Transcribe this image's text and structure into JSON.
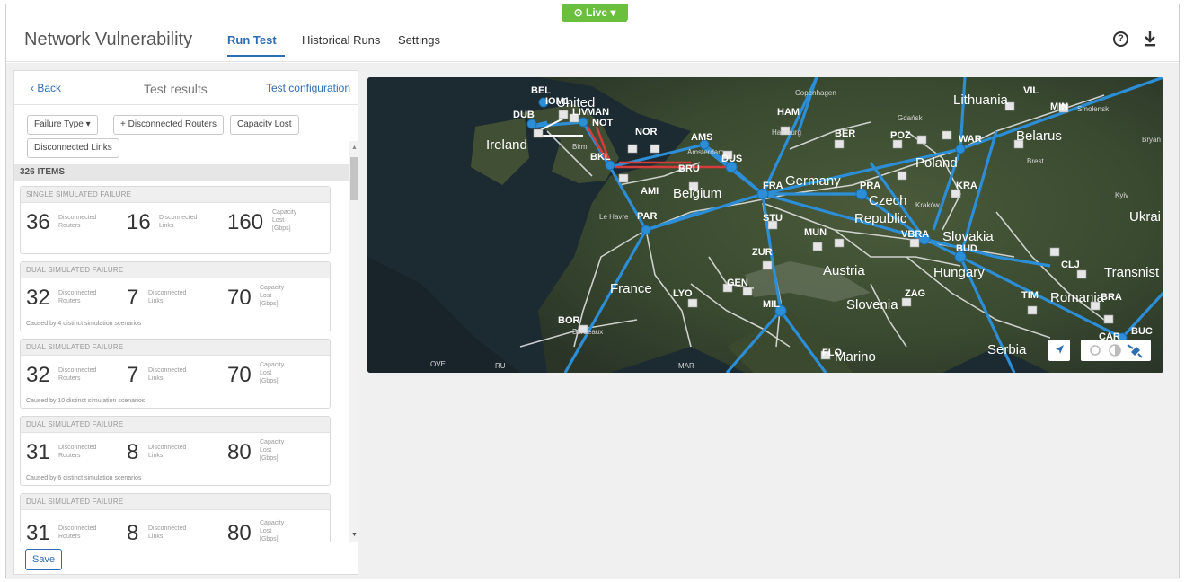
{
  "app": {
    "title": "Network Vulnerability",
    "live_badge": "⊙ Live ▾"
  },
  "nav": {
    "tabs": [
      {
        "label": "Run Test",
        "active": true
      },
      {
        "label": "Historical Runs",
        "active": false
      },
      {
        "label": "Settings",
        "active": false
      }
    ]
  },
  "header_icons": [
    "help-icon",
    "download-icon"
  ],
  "panel": {
    "back_label": "‹  Back",
    "title": "Test results",
    "config_link": "Test configuration",
    "filters": [
      "Failure Type ▾",
      "+ Disconnected Routers",
      "Capacity Lost",
      "Disconnected Links"
    ],
    "items_count": "326 ITEMS",
    "save_label": "Save"
  },
  "results": [
    {
      "type": "SINGLE SIMULATED FAILURE",
      "routers": "36",
      "links": "16",
      "capacity": "160",
      "cause": ""
    },
    {
      "type": "DUAL SIMULATED FAILURE",
      "routers": "32",
      "links": "7",
      "capacity": "70",
      "cause": "Caused by 4 distinct simulation scenarios"
    },
    {
      "type": "DUAL SIMULATED FAILURE",
      "routers": "32",
      "links": "7",
      "capacity": "70",
      "cause": "Caused by 10 distinct simulation scenarios"
    },
    {
      "type": "DUAL SIMULATED FAILURE",
      "routers": "31",
      "links": "8",
      "capacity": "80",
      "cause": "Caused by 6 distinct simulation scenarios"
    },
    {
      "type": "DUAL SIMULATED FAILURE",
      "routers": "31",
      "links": "8",
      "capacity": "80",
      "cause": ""
    }
  ],
  "metric_labels": {
    "routers": "Disconnected\nRouters",
    "links": "Disconnected\nLinks",
    "capacity": "Capacity\nLost\n[Gbps]"
  },
  "map": {
    "countries": [
      "United",
      "Ireland",
      "Belgium",
      "France",
      "Austria",
      "Slovenia",
      "Hungary",
      "Lithuania",
      "Belarus",
      "Poland",
      "Germany",
      "Czech",
      "Republic",
      "Slovakia",
      "Ukrai",
      "Transnist",
      "Romania",
      "Serbia",
      "Marino"
    ],
    "nodes": [
      "BEL",
      "IOM1",
      "DUB",
      "LIV",
      "MAN",
      "NOT",
      "BKL",
      "NOR",
      "AMS",
      "BRU",
      "DUS",
      "HAM",
      "BER",
      "POZ",
      "WAR",
      "MIN",
      "VIL",
      "AMI",
      "PAR",
      "FRA",
      "STU",
      "PRA",
      "KRA",
      "ZUR",
      "MUN",
      "VBRA",
      "BUD",
      "CLJ",
      "GEN",
      "LYO",
      "MIL",
      "ZAG",
      "TIM",
      "BRA",
      "BOR",
      "CAR",
      "BUC",
      "FLO"
    ],
    "small_labels": [
      "Copenhagen",
      "Gdańsk",
      "Hamburg",
      "Smolensk",
      "Bryan",
      "Brest",
      "Kyiv",
      "Le Havre",
      "Birm",
      "Amsterdam",
      "Kraków",
      "Bordeaux",
      "OVE",
      "RU",
      "MAR"
    ],
    "controls": [
      "navigate-icon",
      "sun-icon",
      "moon-icon",
      "satellite-icon"
    ]
  }
}
